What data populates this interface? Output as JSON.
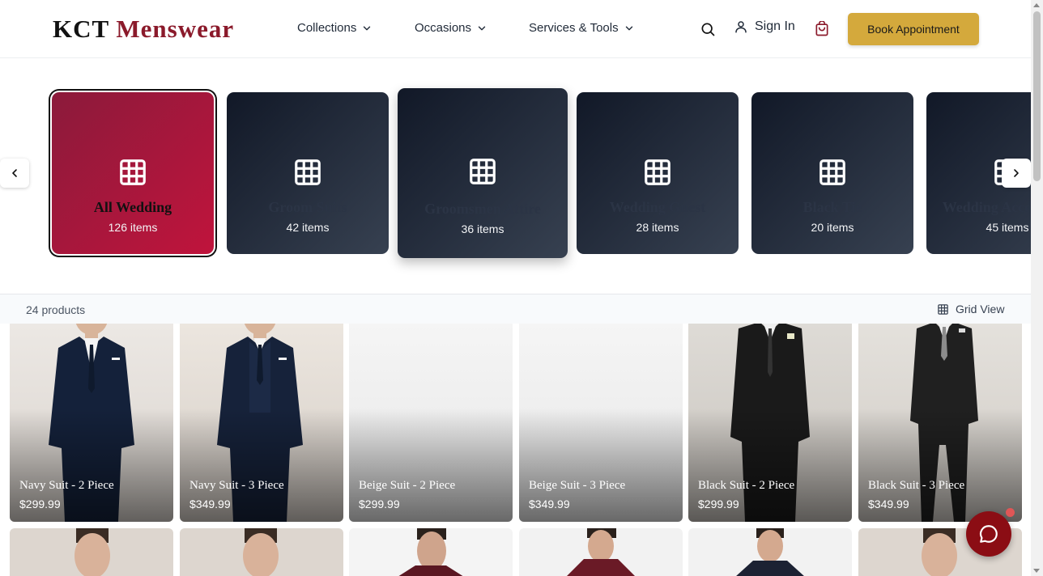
{
  "header": {
    "logo_main": "KCT",
    "logo_accent": "Menswear",
    "nav": [
      {
        "label": "Collections"
      },
      {
        "label": "Occasions"
      },
      {
        "label": "Services & Tools"
      }
    ],
    "sign_in": "Sign In",
    "book_button": "Book Appointment"
  },
  "categories": [
    {
      "title": "All Wedding",
      "count": "126 items",
      "active": true
    },
    {
      "title": "Groom Suits",
      "count": "42 items"
    },
    {
      "title": "Groomsmen Attire",
      "count": "36 items"
    },
    {
      "title": "Wedding Guest",
      "count": "28 items"
    },
    {
      "title": "Black Tie",
      "count": "20 items"
    },
    {
      "title": "Wedding Accessories",
      "count": "45 items"
    }
  ],
  "toolbar": {
    "product_count": "24 products",
    "view_label": "Grid View"
  },
  "products": [
    {
      "name": "Navy Suit - 2 Piece",
      "price": "$299.99",
      "suit_color": "#14213a"
    },
    {
      "name": "Navy Suit - 3 Piece",
      "price": "$349.99",
      "suit_color": "#16223a"
    },
    {
      "name": "Beige Suit - 2 Piece",
      "price": "$299.99",
      "suit_color": ""
    },
    {
      "name": "Beige Suit - 3 Piece",
      "price": "$349.99",
      "suit_color": ""
    },
    {
      "name": "Black Suit - 2 Piece",
      "price": "$299.99",
      "suit_color": "#1a1a1a"
    },
    {
      "name": "Black Suit - 3 Piece",
      "price": "$349.99",
      "suit_color": "#202020"
    }
  ],
  "colors": {
    "brand_red": "#8b1a2b",
    "gold": "#d4a93c",
    "chat": "#8b0d14"
  }
}
